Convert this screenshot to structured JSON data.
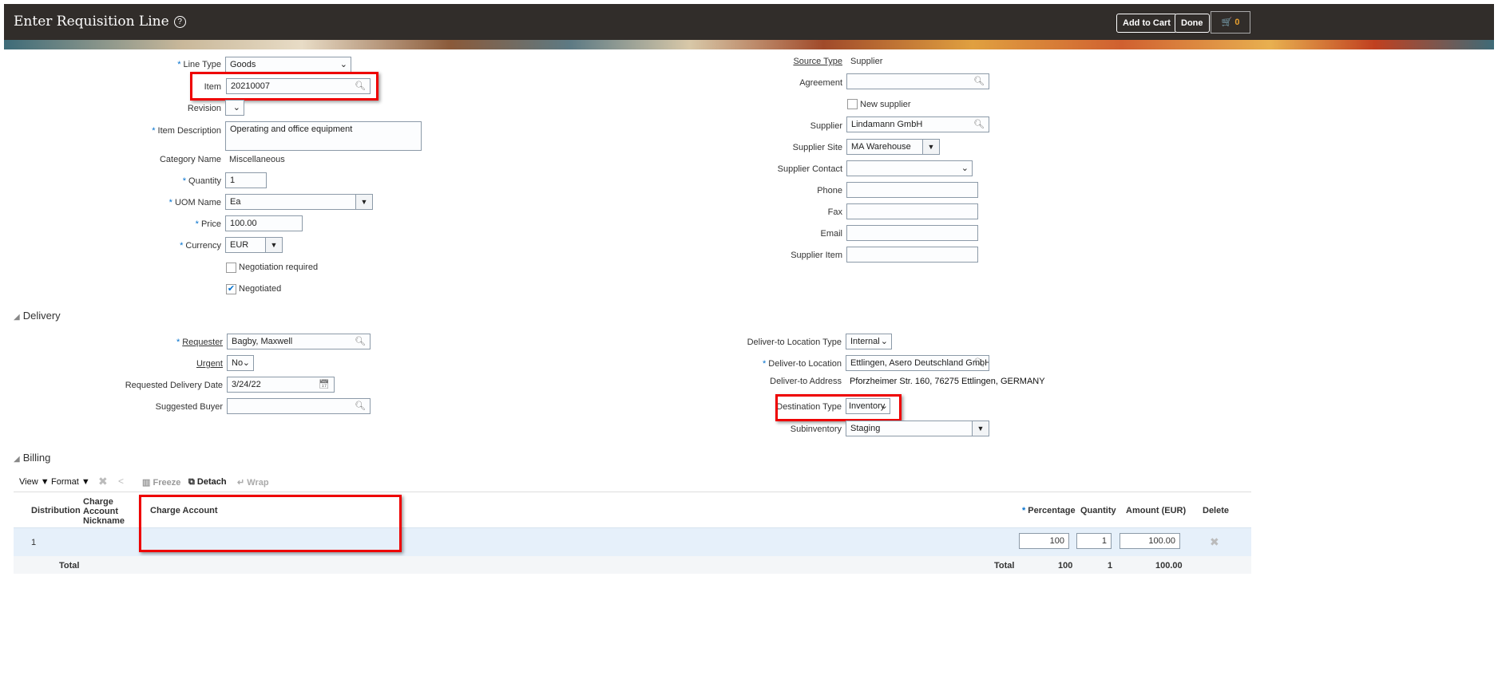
{
  "header": {
    "title": "Enter Requisition Line",
    "add_to_cart": "Add to Cart",
    "done": "Done",
    "cart_count": "0"
  },
  "main": {
    "line_type": {
      "label": "Line Type",
      "value": "Goods"
    },
    "item": {
      "label": "Item",
      "value": "20210007"
    },
    "revision": {
      "label": "Revision",
      "value": ""
    },
    "item_description": {
      "label": "Item Description",
      "value": "Operating and office equipment"
    },
    "category": {
      "label": "Category Name",
      "value": "Miscellaneous"
    },
    "quantity": {
      "label": "Quantity",
      "value": "1"
    },
    "uom": {
      "label": "UOM Name",
      "value": "Ea"
    },
    "price": {
      "label": "Price",
      "value": "100.00"
    },
    "currency": {
      "label": "Currency",
      "value": "EUR"
    },
    "negotiation_required": {
      "label": "Negotiation required",
      "checked": false
    },
    "negotiated": {
      "label": "Negotiated",
      "checked": true
    },
    "source_type": {
      "label": "Source Type",
      "value": "Supplier"
    },
    "agreement": {
      "label": "Agreement",
      "value": ""
    },
    "new_supplier": {
      "label": "New supplier",
      "checked": false
    },
    "supplier": {
      "label": "Supplier",
      "value": "Lindamann GmbH"
    },
    "supplier_site": {
      "label": "Supplier Site",
      "value": "MA Warehouse"
    },
    "supplier_contact": {
      "label": "Supplier Contact",
      "value": ""
    },
    "phone": {
      "label": "Phone",
      "value": ""
    },
    "fax": {
      "label": "Fax",
      "value": ""
    },
    "email": {
      "label": "Email",
      "value": ""
    },
    "supplier_item": {
      "label": "Supplier Item",
      "value": ""
    }
  },
  "delivery": {
    "title": "Delivery",
    "requester": {
      "label": "Requester",
      "value": "Bagby, Maxwell"
    },
    "urgent": {
      "label": "Urgent",
      "value": "No"
    },
    "requested_date": {
      "label": "Requested Delivery Date",
      "value": "3/24/22"
    },
    "suggested_buyer": {
      "label": "Suggested Buyer",
      "value": ""
    },
    "location_type": {
      "label": "Deliver-to Location Type",
      "value": "Internal"
    },
    "location": {
      "label": "Deliver-to Location",
      "value": "Ettlingen, Asero Deutschland GmbH"
    },
    "address": {
      "label": "Deliver-to Address",
      "value": "Pforzheimer Str. 160, 76275 Ettlingen, GERMANY"
    },
    "destination_type": {
      "label": "Destination Type",
      "value": "Inventory"
    },
    "subinventory": {
      "label": "Subinventory",
      "value": "Staging"
    }
  },
  "billing": {
    "title": "Billing",
    "toolbar": {
      "view": "View",
      "format": "Format",
      "freeze": "Freeze",
      "detach": "Detach",
      "wrap": "Wrap"
    },
    "columns": [
      "Distribution",
      "Charge Account Nickname",
      "Charge Account",
      "Percentage",
      "Quantity",
      "Amount (EUR)",
      "Delete"
    ],
    "row": {
      "distribution": "1",
      "nickname": "",
      "charge_account": "",
      "percentage": "100",
      "quantity": "1",
      "amount": "100.00"
    },
    "total": {
      "label": "Total",
      "label2": "Total",
      "percentage": "100",
      "quantity": "1",
      "amount": "100.00"
    }
  }
}
